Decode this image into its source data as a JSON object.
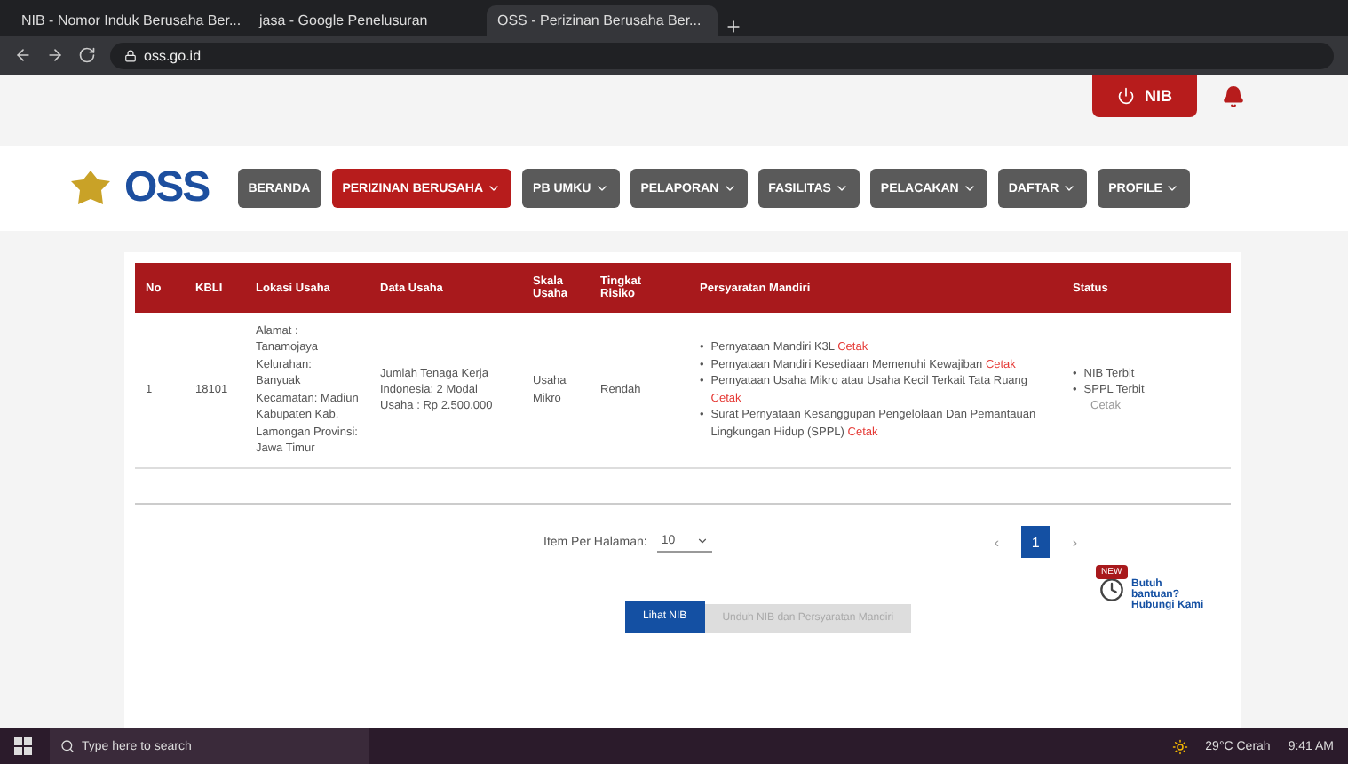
{
  "browser": {
    "tabs": [
      {
        "title": "NIB - Nomor Induk Berusaha Ber...",
        "selected": false
      },
      {
        "title": "jasa - Google Penelusuran",
        "selected": false
      },
      {
        "title": "OSS - Perizinan Berusaha Ber...",
        "selected": true
      }
    ],
    "url": "oss.go.id"
  },
  "header": {
    "user_button": "NIB"
  },
  "logo": "OSS",
  "bullet": "•",
  "nav": [
    {
      "label": "BERANDA",
      "selected": false,
      "dropdown": false
    },
    {
      "label": "PERIZINAN BERUSAHA",
      "selected": true,
      "dropdown": true
    },
    {
      "label": "PB UMKU",
      "selected": false,
      "dropdown": true
    },
    {
      "label": "PELAPORAN",
      "selected": false,
      "dropdown": true
    },
    {
      "label": "FASILITAS",
      "selected": false,
      "dropdown": true
    },
    {
      "label": "PELACAKAN",
      "selected": false,
      "dropdown": true
    },
    {
      "label": "DAFTAR",
      "selected": false,
      "dropdown": true
    },
    {
      "label": "PROFILE",
      "selected": false,
      "dropdown": true
    }
  ],
  "table": {
    "columns": [
      "No",
      "KBLI",
      "Lokasi Usaha",
      "Data Usaha",
      "Skala Usaha",
      "Tingkat Risiko",
      "Persyaratan Mandiri",
      "Status"
    ],
    "rows": [
      {
        "no": "1",
        "kbli": "18101",
        "lokasi": "Alamat : Tanamojaya Kelurahan: Banyuak Kecamatan: Madiun Kabupaten Kab. Lamongan Provinsi: Jawa Timur",
        "data_usaha": "Jumlah Tenaga Kerja Indonesia: 2 Modal Usaha : Rp 2.500.000",
        "skala": "Usaha Mikro",
        "risiko": "Rendah",
        "persyaratan": [
          {
            "text": "Pernyataan Mandiri K3L",
            "link": "Cetak"
          },
          {
            "text": "Pernyataan Mandiri Kesediaan Memenuhi Kewajiban",
            "link": "Cetak"
          },
          {
            "text": "Pernyataan Usaha Mikro atau Usaha Kecil Terkait Tata Ruang",
            "link": "Cetak"
          },
          {
            "text": "Surat Pernyataan Kesanggupan Pengelolaan Dan Pemantauan Lingkungan Hidup (SPPL)",
            "link": "Cetak"
          }
        ],
        "status": [
          "NIB Terbit",
          "SPPL Terbit"
        ],
        "status_note": "Cetak"
      }
    ]
  },
  "pagination": {
    "label": "Item Per Halaman:",
    "per_page": "10",
    "prev": "‹",
    "pages": [
      {
        "label": "1",
        "selected": true
      }
    ],
    "next": "›"
  },
  "footer": {
    "primary_button": "Lihat NIB",
    "secondary_button": "Unduh NIB dan Persyaratan Mandiri"
  },
  "help": {
    "badge": "NEW",
    "text": "Butuh bantuan? Hubungi Kami"
  },
  "taskbar": {
    "search": "Type here to search",
    "weather": "29°C Cerah",
    "time": "9:41 AM"
  }
}
